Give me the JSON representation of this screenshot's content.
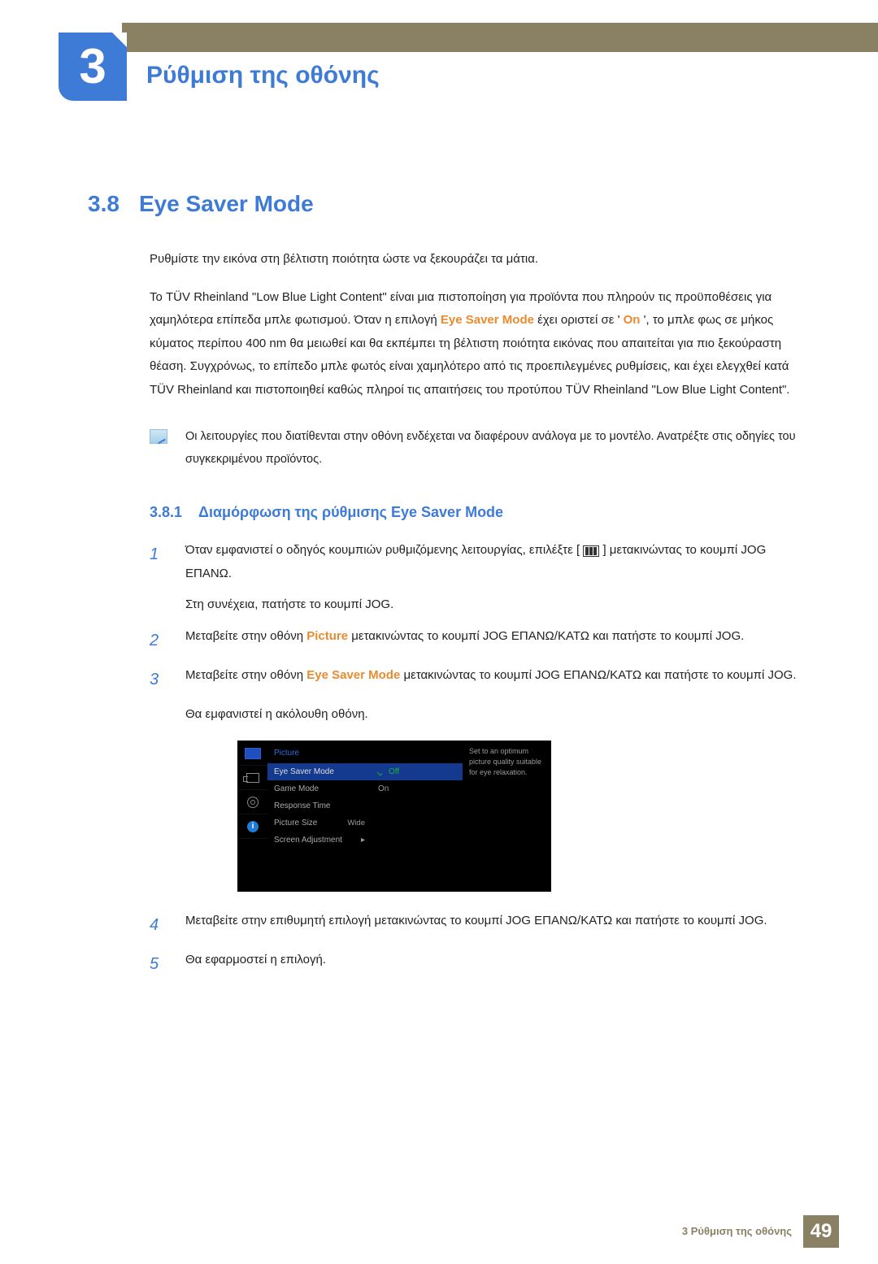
{
  "chapter": {
    "number": "3",
    "title": "Ρύθμιση της οθόνης"
  },
  "section": {
    "number": "3.8",
    "title": "Eye Saver Mode"
  },
  "intro": "Ρυθμίστε την εικόνα στη βέλτιστη ποιότητα ώστε να ξεκουράζει τα μάτια.",
  "body": {
    "p1_a": "Το TÜV Rheinland \"Low Blue Light Content\" είναι μια πιστοποίηση για προϊόντα που πληρούν τις προϋποθέσεις για χαμηλότερα επίπεδα μπλε φωτισμού. Όταν η επιλογή ",
    "p1_hl1": "Eye Saver Mode",
    "p1_b": " έχει οριστεί σε '",
    "p1_hl2": "On",
    "p1_c": "', το μπλε φως σε μήκος κύματος περίπου 400 nm θα μειωθεί και θα εκπέμπει τη βέλτιστη ποιότητα εικόνας που απαιτείται για πιο ξεκούραστη θέαση. Συγχρόνως, το επίπεδο μπλε φωτός είναι χαμηλότερο από τις προεπιλεγμένες ρυθμίσεις, και έχει ελεγχθεί κατά TÜV Rheinland και πιστοποιηθεί καθώς πληροί τις απαιτήσεις του προτύπου TÜV Rheinland \"Low Blue Light Content\"."
  },
  "note": "Οι λειτουργίες που διατίθενται στην οθόνη ενδέχεται να διαφέρουν ανάλογα με το μοντέλο. Ανατρέξτε στις οδηγίες του συγκεκριμένου προϊόντος.",
  "subsection": {
    "number": "3.8.1",
    "title": "Διαμόρφωση της ρύθμισης Eye Saver Mode"
  },
  "steps": {
    "s1_num": "1",
    "s1_a": "Όταν εμφανιστεί ο οδηγός κουμπιών ρυθμιζόμενης λειτουργίας, επιλέξτε [",
    "s1_b": "] μετακινώντας το κουμπί JOG ΕΠΑΝΩ.",
    "s1_sub": "Στη συνέχεια, πατήστε το κουμπί JOG.",
    "s2_num": "2",
    "s2_a": "Μεταβείτε στην οθόνη ",
    "s2_hl": "Picture",
    "s2_b": " μετακινώντας το κουμπί JOG ΕΠΑΝΩ/ΚΑΤΩ και πατήστε το κουμπί JOG.",
    "s3_num": "3",
    "s3_a": "Μεταβείτε στην οθόνη ",
    "s3_hl": "Eye Saver Mode",
    "s3_b": " μετακινώντας το κουμπί JOG ΕΠΑΝΩ/ΚΑΤΩ και πατήστε το κουμπί JOG.",
    "s3_sub": "Θα εμφανιστεί η ακόλουθη οθόνη.",
    "s4_num": "4",
    "s4": "Μεταβείτε στην επιθυμητή επιλογή μετακινώντας το κουμπί JOG ΕΠΑΝΩ/ΚΑΤΩ και πατήστε το κουμπί JOG.",
    "s5_num": "5",
    "s5": "Θα εφαρμοστεί η επιλογή."
  },
  "osd": {
    "menu_title": "Picture",
    "items": {
      "eye": "Eye Saver Mode",
      "game": "Game Mode",
      "response": "Response Time",
      "size": "Picture Size",
      "adjust": "Screen Adjustment"
    },
    "values": {
      "off": "Off",
      "on": "On",
      "wide": "Wide",
      "arrow": "▸"
    },
    "desc": "Set to an optimum picture quality suitable for eye relaxation.",
    "info_i": "i"
  },
  "footer": {
    "text": "3 Ρύθμιση της οθόνης",
    "page": "49"
  }
}
